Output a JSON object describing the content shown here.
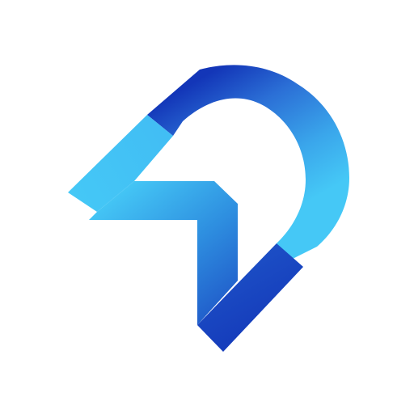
{
  "background_color": "#ffffff",
  "logo": {
    "icon": "abstract-blue-arrow-pin-logo",
    "colors": {
      "light": "#45c8f6",
      "mid": "#2b86dc",
      "dark": "#1336b8"
    }
  }
}
